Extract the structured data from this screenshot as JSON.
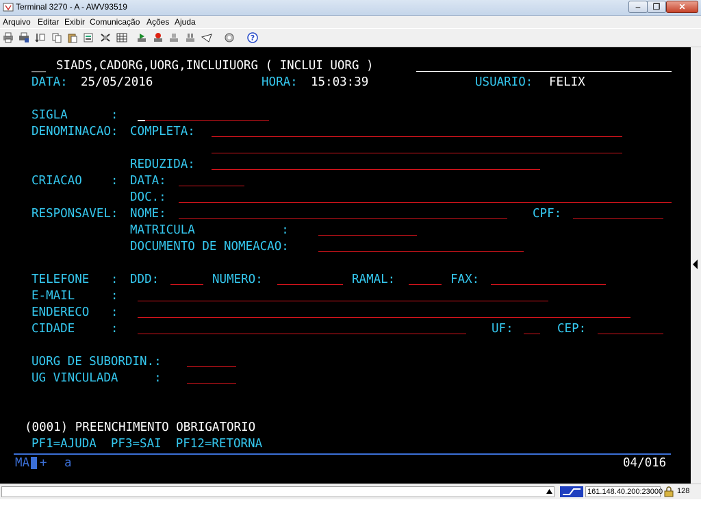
{
  "window": {
    "title": "Terminal 3270 - A - AWV93519"
  },
  "menu": [
    "Arquivo",
    "Editar",
    "Exibir",
    "Comunicação",
    "Ações",
    "Ajuda"
  ],
  "toolbar_icons": [
    "print-screen-icon",
    "print-setup-icon",
    "transfer-icon",
    "copy-icon",
    "paste-icon",
    "clipboard-icon",
    "macro-icon",
    "keypad-icon",
    "play-icon",
    "record-icon",
    "stop-icon",
    "pause-icon",
    "send-icon",
    "settings-icon",
    "help-icon"
  ],
  "screen": {
    "header_prefix": "__",
    "header_title": "SIADS,CADORG,UORG,INCLUIUORG ( INCLUI UORG )",
    "data_label": "DATA:",
    "data_value": "25/05/2016",
    "hora_label": "HORA:",
    "hora_value": "15:03:39",
    "usuario_label": "USUARIO:",
    "usuario_value": "FELIX",
    "sigla_label": "SIGLA      :",
    "denominacao_label": "DENOMINACAO:",
    "completa_label": "COMPLETA:",
    "reduzida_label": "REDUZIDA:",
    "criacao_label": "CRIACAO    :",
    "criacao_data_label": "DATA:",
    "doc_label": "DOC.:",
    "responsavel_label": "RESPONSAVEL:",
    "nome_label": "NOME:",
    "cpf_label": "CPF:",
    "matricula_label": "MATRICULA            :",
    "doc_nomeacao_label": "DOCUMENTO DE NOMEACAO:",
    "telefone_label": "TELEFONE   :",
    "ddd_label": "DDD:",
    "numero_label": "NUMERO:",
    "ramal_label": "RAMAL:",
    "fax_label": "FAX:",
    "email_label": "E-MAIL     :",
    "endereco_label": "ENDERECO   :",
    "cidade_label": "CIDADE     :",
    "uf_label": "UF:",
    "cep_label": "CEP:",
    "uorg_subordin_label": "UORG DE SUBORDIN.:",
    "ug_vinculada_label": "UG VINCULADA     :",
    "message": "(0001) PREENCHIMENTO OBRIGATORIO",
    "pf_keys": "PF1=AJUDA  PF3=SAI  PF12=RETORNA"
  },
  "oia": {
    "ma": "MA",
    "plus": "+",
    "a": "a",
    "cursor_pos": "04/016"
  },
  "statusbar": {
    "host": "161.148.40.200:23000",
    "code": "128"
  },
  "colors": {
    "terminal_bg": "#000000",
    "label_cyan": "#35c8ef",
    "value_white": "#ffffff",
    "field_red": "#d8141c",
    "oia_blue": "#3b6fd6"
  }
}
